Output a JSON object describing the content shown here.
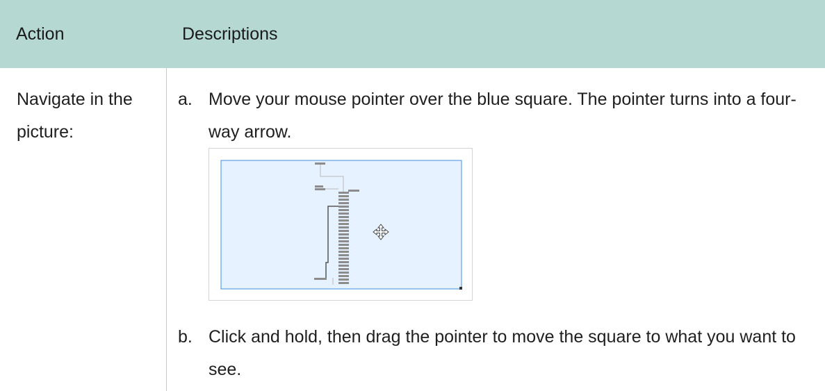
{
  "table": {
    "headers": {
      "action": "Action",
      "descriptions": "Descriptions"
    },
    "rows": [
      {
        "action": "Navigate in the picture:",
        "steps": [
          {
            "marker": "a.",
            "text": "Move your mouse pointer over the blue square. The pointer turns into a four-way arrow."
          },
          {
            "marker": "b.",
            "text": "Click and hold, then drag the pointer to move the square to what you want to see."
          }
        ]
      }
    ]
  },
  "figure": {
    "icon": "four-way-arrow-icon",
    "viewport_color": "#e6f2ff",
    "viewport_border_color": "#3f8fe0"
  },
  "colors": {
    "header_background": "#b5d9d2",
    "divider": "#c9c9c9"
  }
}
